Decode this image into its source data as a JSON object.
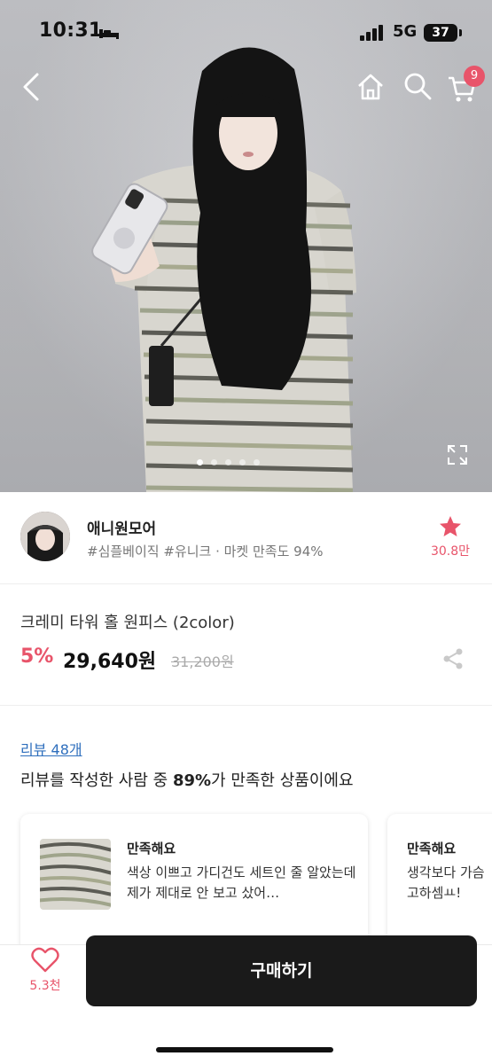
{
  "status_bar": {
    "time": "10:31",
    "network": "5G",
    "battery": "37"
  },
  "nav": {
    "cart_badge": "9",
    "icons": [
      "back-arrow-icon",
      "home-icon",
      "search-icon",
      "cart-icon",
      "expand-icon"
    ]
  },
  "gallery": {
    "slide_count": 5,
    "active_slide": 1
  },
  "seller": {
    "name": "애니원모어",
    "tags": "#심플베이직 #유니크 · 마켓 만족도 94%",
    "favorite_count": "30.8만"
  },
  "product": {
    "name": "크레미 타워 홀 원피스 (2color)",
    "discount": "5%",
    "price": "29,640원",
    "original_price": "31,200원"
  },
  "reviews": {
    "link_label": "리뷰 48개",
    "summary_prefix": "리뷰를 작성한 사람 중 ",
    "summary_percent": "89%",
    "summary_suffix": "가 만족한 상품이에요",
    "cards": [
      {
        "rating": "만족해요",
        "text": "색상 이쁘고 가디건도 세트인 줄 알았는데 제가 제대로 안 보고 샀어…"
      },
      {
        "rating": "만족해요",
        "text": "생각보다 가슴 고하셈ㅛ!"
      }
    ]
  },
  "bottom_bar": {
    "like_count": "5.3천",
    "buy_label": "구매하기"
  },
  "colors": {
    "accent_pink": "#e8546a",
    "link_blue": "#2f6fbd",
    "buy_button": "#1a1a1a"
  }
}
